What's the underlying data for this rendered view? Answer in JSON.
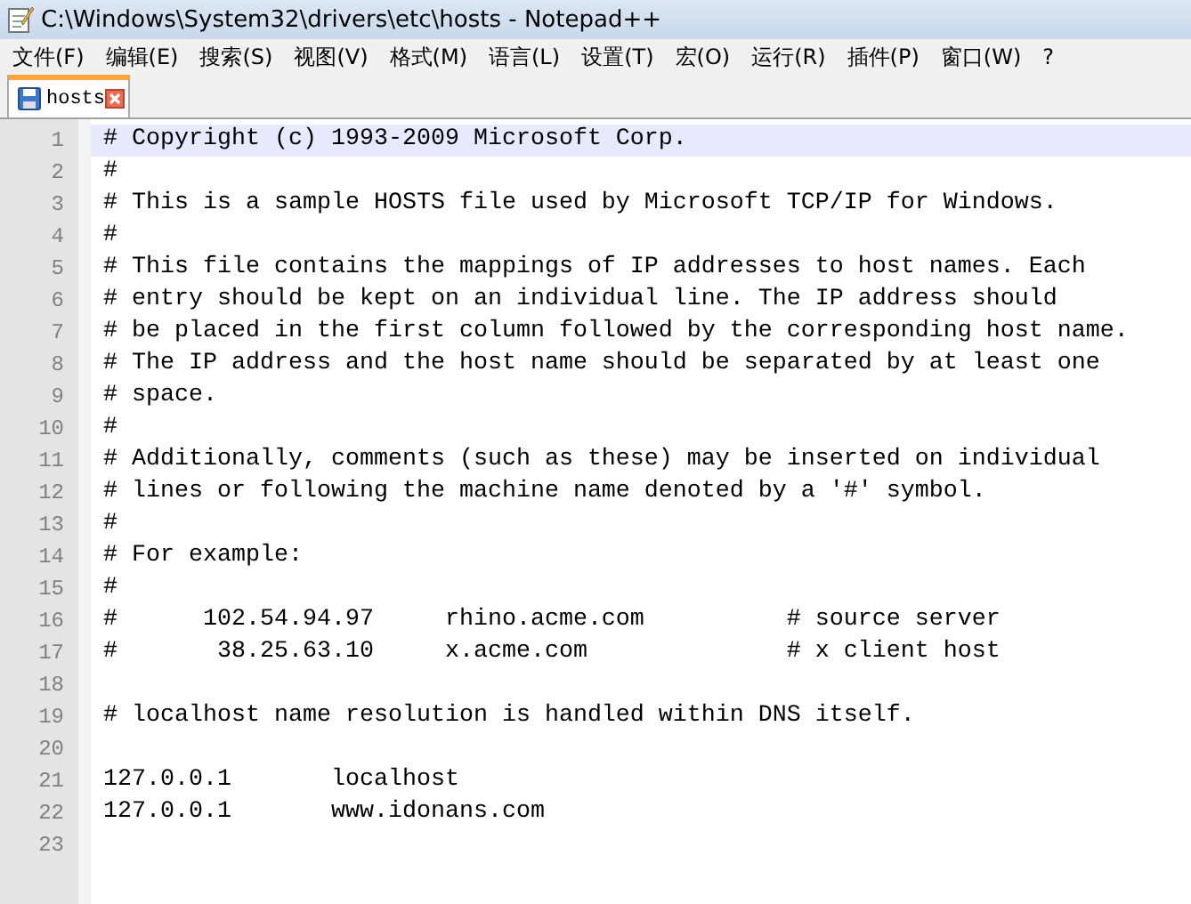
{
  "window": {
    "title": "C:\\Windows\\System32\\drivers\\etc\\hosts - Notepad++"
  },
  "menu": [
    "文件(F)",
    "编辑(E)",
    "搜索(S)",
    "视图(V)",
    "格式(M)",
    "语言(L)",
    "设置(T)",
    "宏(O)",
    "运行(R)",
    "插件(P)",
    "窗口(W)",
    "?"
  ],
  "tabs": [
    {
      "label": "hosts",
      "selected": true
    }
  ],
  "editor": {
    "lines": [
      {
        "number": "1",
        "text": "# Copyright (c) 1993-2009 Microsoft Corp.",
        "current": true
      },
      {
        "number": "2",
        "text": "#",
        "current": false
      },
      {
        "number": "3",
        "text": "# This is a sample HOSTS file used by Microsoft TCP/IP for Windows.",
        "current": false
      },
      {
        "number": "4",
        "text": "#",
        "current": false
      },
      {
        "number": "5",
        "text": "# This file contains the mappings of IP addresses to host names. Each",
        "current": false
      },
      {
        "number": "6",
        "text": "# entry should be kept on an individual line. The IP address should",
        "current": false
      },
      {
        "number": "7",
        "text": "# be placed in the first column followed by the corresponding host name.",
        "current": false
      },
      {
        "number": "8",
        "text": "# The IP address and the host name should be separated by at least one",
        "current": false
      },
      {
        "number": "9",
        "text": "# space.",
        "current": false
      },
      {
        "number": "10",
        "text": "#",
        "current": false
      },
      {
        "number": "11",
        "text": "# Additionally, comments (such as these) may be inserted on individual",
        "current": false
      },
      {
        "number": "12",
        "text": "# lines or following the machine name denoted by a '#' symbol.",
        "current": false
      },
      {
        "number": "13",
        "text": "#",
        "current": false
      },
      {
        "number": "14",
        "text": "# For example:",
        "current": false
      },
      {
        "number": "15",
        "text": "#",
        "current": false
      },
      {
        "number": "16",
        "text": "#      102.54.94.97     rhino.acme.com          # source server",
        "current": false
      },
      {
        "number": "17",
        "text": "#       38.25.63.10     x.acme.com              # x client host",
        "current": false
      },
      {
        "number": "18",
        "current": false
      },
      {
        "number": "19",
        "text": "# localhost name resolution is handled within DNS itself.",
        "current": false
      },
      {
        "number": "20",
        "current": false
      },
      {
        "number": "21",
        "text": "127.0.0.1       localhost",
        "current": false
      },
      {
        "number": "22",
        "text": "127.0.0.1       www.idonans.com",
        "current": false
      },
      {
        "number": "23",
        "current": false
      }
    ]
  }
}
